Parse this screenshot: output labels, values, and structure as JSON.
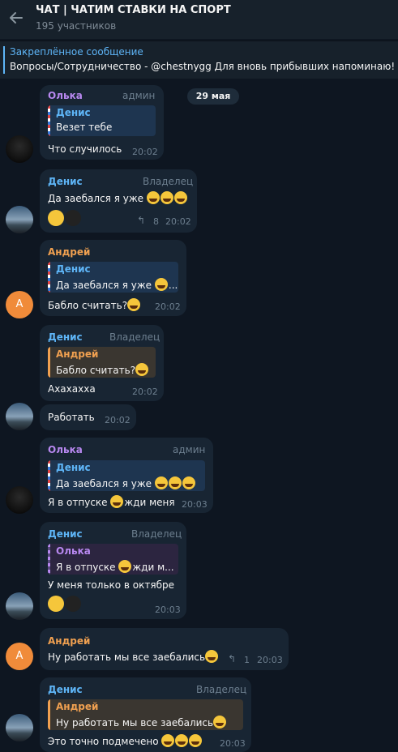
{
  "header": {
    "title": "ЧАТ | ЧАТИМ СТАВКИ НА СПОРТ",
    "subtitle": "195 участников"
  },
  "pinned": {
    "label": "Закреплённое сообщение",
    "text": "Вопросы/Сотрудничество - @chestnygg  Для вновь прибывших напоминаю!"
  },
  "date_chip": "29 мая",
  "messages": [
    {
      "sender": "Олька",
      "sender_color": "#b888f0",
      "role": "админ",
      "quote_name": "Денис",
      "quote_text": "Везет тебе",
      "text": "Что случилось",
      "time": "20:02"
    },
    {
      "sender": "Денис",
      "sender_color": "#5eb5f7",
      "role": "Владелец",
      "text": "Да заебался я уже",
      "replies": "8",
      "time": "20:02"
    },
    {
      "sender": "Андрей",
      "sender_color": "#f0a050",
      "quote_name": "Денис",
      "quote_text": "Да заебался я уже",
      "text": "Бабло считать?",
      "time": "20:02",
      "avatar_letter": "A"
    },
    {
      "sender": "Денис",
      "sender_color": "#5eb5f7",
      "role": "Владелец",
      "quote_name": "Андрей",
      "quote_text": "Бабло считать?",
      "text": "Ахахахха",
      "time": "20:02"
    },
    {
      "text": "Работать",
      "time": "20:02"
    },
    {
      "sender": "Олька",
      "sender_color": "#b888f0",
      "role": "админ",
      "quote_name": "Денис",
      "quote_text": "Да заебался я уже",
      "text": "Я в отпуске",
      "text_after": "жди меня",
      "time": "20:03"
    },
    {
      "sender": "Денис",
      "sender_color": "#5eb5f7",
      "role": "Владелец",
      "quote_name": "Олька",
      "quote_text": "Я в отпуске",
      "quote_text_after": "жди м...",
      "text": "У меня только в октябре",
      "time": "20:03"
    },
    {
      "sender": "Андрей",
      "sender_color": "#f0a050",
      "text": "Ну работать мы все заебались",
      "replies": "1",
      "time": "20:03",
      "avatar_letter": "A"
    },
    {
      "sender": "Денис",
      "sender_color": "#5eb5f7",
      "role": "Владелец",
      "quote_name": "Андрей",
      "quote_text": "Ну работать мы все заебались",
      "text": "Это точно подмечено",
      "time": "20:03"
    }
  ]
}
